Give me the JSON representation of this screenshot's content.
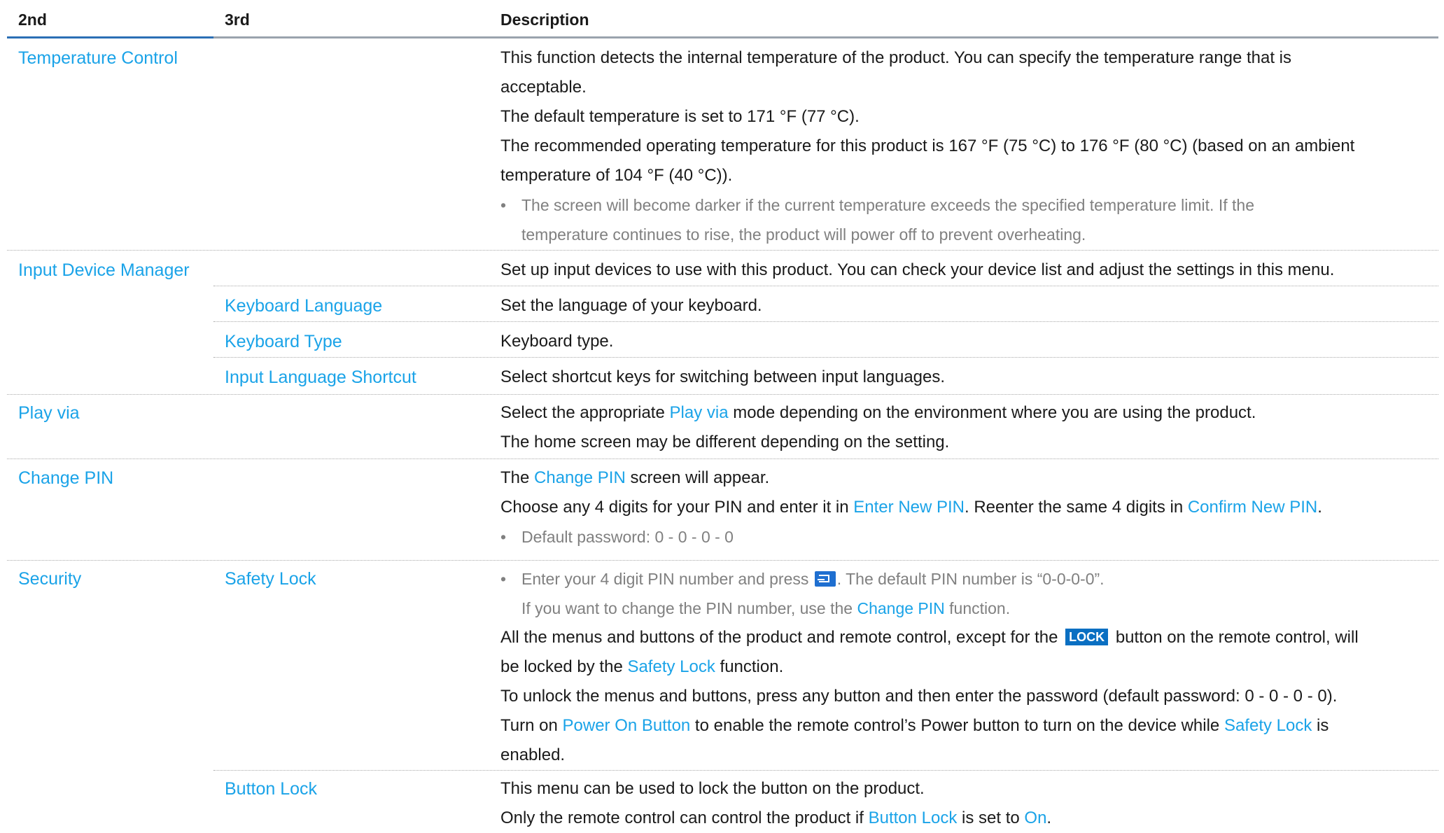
{
  "header": {
    "col1": "2nd",
    "col2": "3rd",
    "col3": "Description"
  },
  "temperature": {
    "label": "Temperature Control",
    "line1": "This function detects the internal temperature of the product. You can specify the temperature range that is",
    "line1b": "acceptable.",
    "line2": "The default temperature is set to 171 °F (77 °C).",
    "line3": "The recommended operating temperature for this product is 167 °F (75 °C) to 176 °F (80 °C) (based on an ambient",
    "line3b": "temperature of 104 °F (40 °C)).",
    "note1": "The screen will become darker if the current temperature exceeds the specified temperature limit. If the",
    "note1b": "temperature continues to rise, the product will power off to prevent overheating."
  },
  "input_device": {
    "label": "Input Device Manager",
    "desc": "Set up input devices to use with this product. You can check your device list and adjust the settings in this menu.",
    "keyboard_language": {
      "label": "Keyboard Language",
      "desc": "Set the language of your keyboard."
    },
    "keyboard_type": {
      "label": "Keyboard Type",
      "desc": "Keyboard type."
    },
    "input_language_shortcut": {
      "label": "Input Language Shortcut",
      "desc": "Select shortcut keys for switching between input languages."
    }
  },
  "play_via": {
    "label": "Play via",
    "l1a": "Select the appropriate ",
    "l1hl": "Play via",
    "l1b": " mode depending on the environment where you are using the product.",
    "l2": "The home screen may be different depending on the setting."
  },
  "change_pin": {
    "label": "Change PIN",
    "l1a": "The ",
    "l1hl": "Change PIN",
    "l1b": " screen will appear.",
    "l2a": "Choose any 4 digits for your PIN and enter it in ",
    "l2hl1": "Enter New PIN",
    "l2b": ". Reenter the same 4 digits in ",
    "l2hl2": "Confirm New PIN",
    "l2c": ".",
    "note": "Default password: 0 - 0 - 0 - 0"
  },
  "security": {
    "label": "Security",
    "safety_lock": {
      "label": "Safety Lock",
      "n1a": "Enter your 4 digit PIN number and press ",
      "n1b": ". The default PIN number is “0-0-0-0”.",
      "n2a": "If you want to change the PIN number, use the ",
      "n2hl": "Change PIN",
      "n2b": " function.",
      "l1a": "All the menus and buttons of the product and remote control, except for the ",
      "lock_badge": "LOCK",
      "l1b": " button on the remote control, will",
      "l2a": "be locked by the ",
      "l2hl": "Safety Lock",
      "l2b": " function.",
      "l3": "To unlock the menus and buttons, press any button and then enter the password (default password: 0 - 0 - 0 - 0).",
      "l4a": "Turn on ",
      "l4hl1": "Power On Button",
      "l4b": " to enable the remote control’s Power button to turn on the device while ",
      "l4hl2": "Safety Lock",
      "l4c": " is",
      "l5": "enabled."
    },
    "button_lock": {
      "label": "Button Lock",
      "l1": "This menu can be used to lock the button on the product.",
      "l2a": "Only the remote control can control the product if ",
      "l2hl1": "Button Lock",
      "l2b": " is set to ",
      "l2hl2": "On",
      "l2c": "."
    }
  }
}
